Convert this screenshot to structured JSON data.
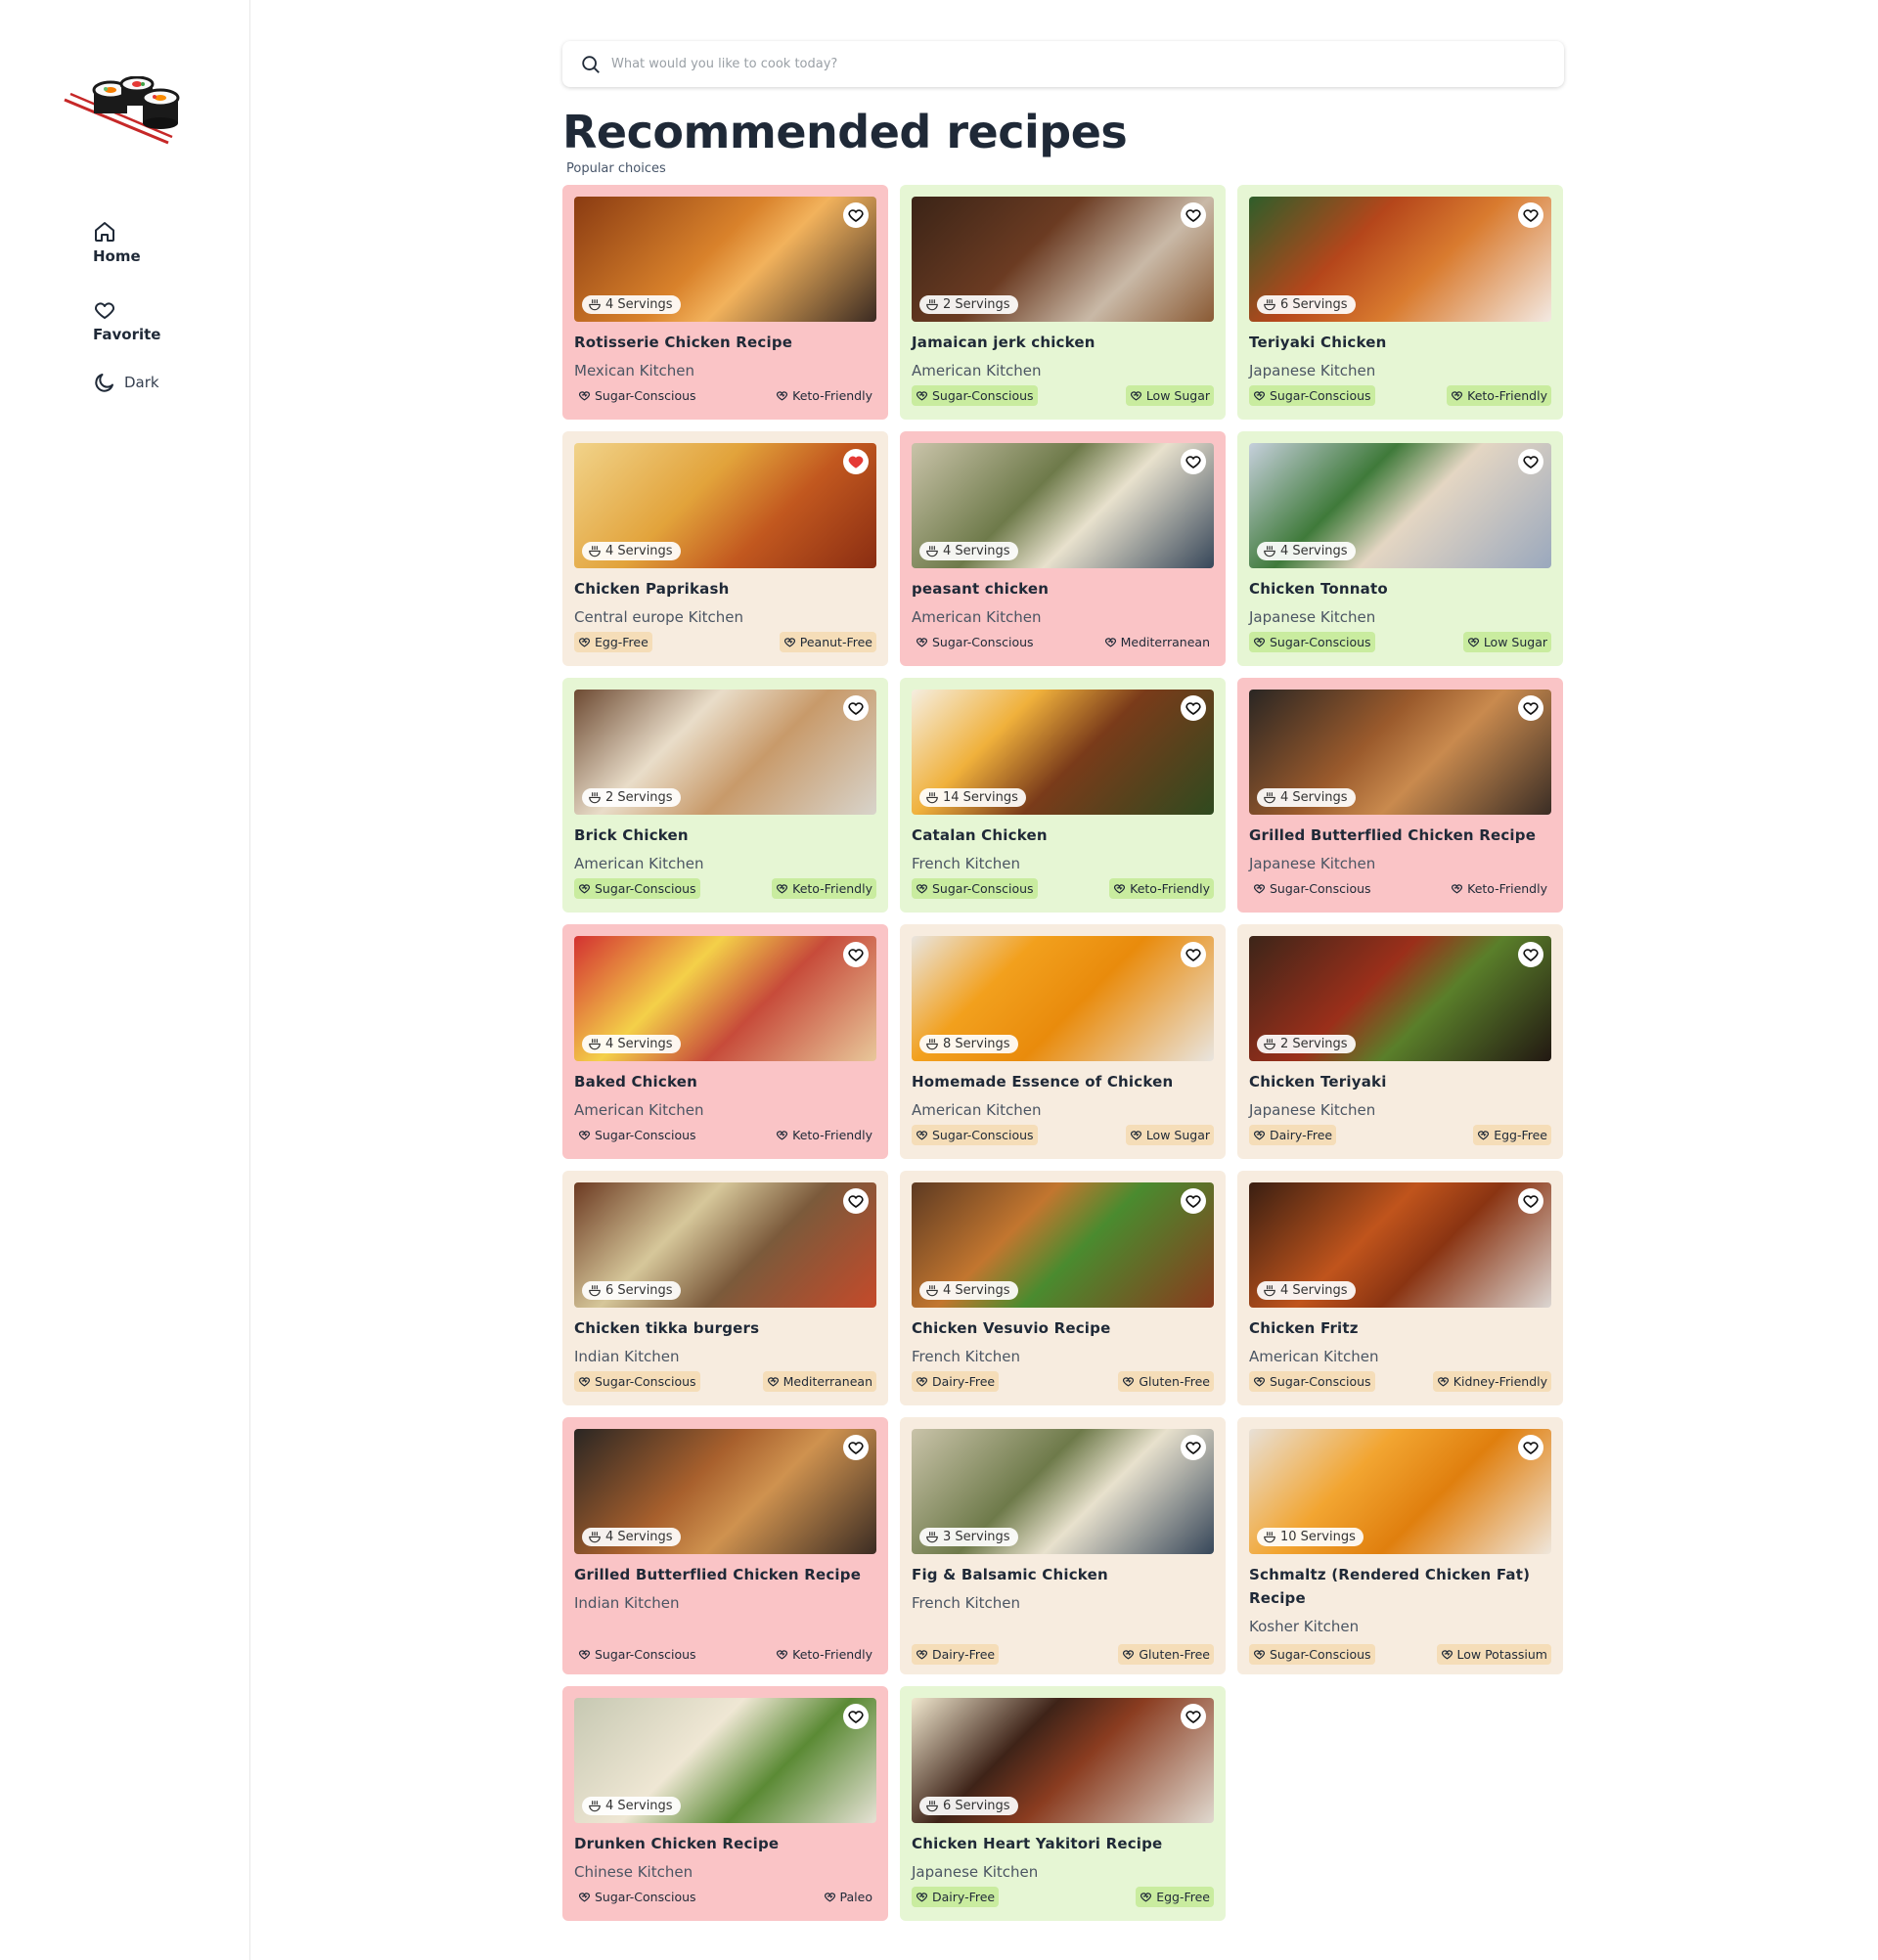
{
  "sidebar": {
    "nav": [
      {
        "label": "Home",
        "icon": "home-icon"
      },
      {
        "label": "Favorite",
        "icon": "heart-icon"
      },
      {
        "label": "Dark",
        "icon": "moon-icon"
      }
    ]
  },
  "search": {
    "placeholder": "What would you like to cook today?",
    "value": ""
  },
  "header": {
    "title": "Recommended recipes",
    "subtitle": "Popular choices"
  },
  "colors": {
    "pink": "#fac4c6",
    "green": "#e6f6d4",
    "beige": "#f7ecdf",
    "fav_active": "#e53935"
  },
  "recipes": [
    {
      "title": "Rotisserie Chicken Recipe",
      "kitchen": "Mexican Kitchen",
      "servings": "4 Servings",
      "tags": [
        "Sugar-Conscious",
        "Keto-Friendly"
      ],
      "color": "pink",
      "favorite": false
    },
    {
      "title": "Jamaican jerk chicken",
      "kitchen": "American Kitchen",
      "servings": "2 Servings",
      "tags": [
        "Sugar-Conscious",
        "Low Sugar"
      ],
      "color": "green",
      "favorite": false
    },
    {
      "title": "Teriyaki Chicken",
      "kitchen": "Japanese Kitchen",
      "servings": "6 Servings",
      "tags": [
        "Sugar-Conscious",
        "Keto-Friendly"
      ],
      "color": "green",
      "favorite": false
    },
    {
      "title": "Chicken Paprikash",
      "kitchen": "Central europe Kitchen",
      "servings": "4 Servings",
      "tags": [
        "Egg-Free",
        "Peanut-Free"
      ],
      "color": "beige",
      "favorite": true
    },
    {
      "title": "peasant chicken",
      "kitchen": "American Kitchen",
      "servings": "4 Servings",
      "tags": [
        "Sugar-Conscious",
        "Mediterranean"
      ],
      "color": "pink",
      "favorite": false
    },
    {
      "title": "Chicken Tonnato",
      "kitchen": "Japanese Kitchen",
      "servings": "4 Servings",
      "tags": [
        "Sugar-Conscious",
        "Low Sugar"
      ],
      "color": "green",
      "favorite": false
    },
    {
      "title": "Brick Chicken",
      "kitchen": "American Kitchen",
      "servings": "2 Servings",
      "tags": [
        "Sugar-Conscious",
        "Keto-Friendly"
      ],
      "color": "green",
      "favorite": false
    },
    {
      "title": "Catalan Chicken",
      "kitchen": "French Kitchen",
      "servings": "14 Servings",
      "tags": [
        "Sugar-Conscious",
        "Keto-Friendly"
      ],
      "color": "green",
      "favorite": false
    },
    {
      "title": "Grilled Butterflied Chicken Recipe",
      "kitchen": "Japanese Kitchen",
      "servings": "4 Servings",
      "tags": [
        "Sugar-Conscious",
        "Keto-Friendly"
      ],
      "color": "pink",
      "favorite": false
    },
    {
      "title": "Baked Chicken",
      "kitchen": "American Kitchen",
      "servings": "4 Servings",
      "tags": [
        "Sugar-Conscious",
        "Keto-Friendly"
      ],
      "color": "pink",
      "favorite": false
    },
    {
      "title": "Homemade Essence of Chicken",
      "kitchen": "American Kitchen",
      "servings": "8 Servings",
      "tags": [
        "Sugar-Conscious",
        "Low Sugar"
      ],
      "color": "beige",
      "favorite": false
    },
    {
      "title": "Chicken Teriyaki",
      "kitchen": "Japanese Kitchen",
      "servings": "2 Servings",
      "tags": [
        "Dairy-Free",
        "Egg-Free"
      ],
      "color": "beige",
      "favorite": false
    },
    {
      "title": "Chicken tikka burgers",
      "kitchen": "Indian Kitchen",
      "servings": "6 Servings",
      "tags": [
        "Sugar-Conscious",
        "Mediterranean"
      ],
      "color": "beige",
      "favorite": false
    },
    {
      "title": "Chicken Vesuvio Recipe",
      "kitchen": "French Kitchen",
      "servings": "4 Servings",
      "tags": [
        "Dairy-Free",
        "Gluten-Free"
      ],
      "color": "beige",
      "favorite": false
    },
    {
      "title": "Chicken Fritz",
      "kitchen": "American Kitchen",
      "servings": "4 Servings",
      "tags": [
        "Sugar-Conscious",
        "Kidney-Friendly"
      ],
      "color": "beige",
      "favorite": false
    },
    {
      "title": "Grilled Butterflied Chicken Recipe",
      "kitchen": "Indian Kitchen",
      "servings": "4 Servings",
      "tags": [
        "Sugar-Conscious",
        "Keto-Friendly"
      ],
      "color": "pink",
      "favorite": false
    },
    {
      "title": "Fig & Balsamic Chicken",
      "kitchen": "French Kitchen",
      "servings": "3 Servings",
      "tags": [
        "Dairy-Free",
        "Gluten-Free"
      ],
      "color": "beige",
      "favorite": false
    },
    {
      "title": "Schmaltz (Rendered Chicken Fat) Recipe",
      "kitchen": "Kosher Kitchen",
      "servings": "10 Servings",
      "tags": [
        "Sugar-Conscious",
        "Low Potassium"
      ],
      "color": "beige",
      "favorite": false
    },
    {
      "title": "Drunken Chicken Recipe",
      "kitchen": "Chinese Kitchen",
      "servings": "4 Servings",
      "tags": [
        "Sugar-Conscious",
        "Paleo"
      ],
      "color": "pink",
      "favorite": false
    },
    {
      "title": "Chicken Heart Yakitori Recipe",
      "kitchen": "Japanese Kitchen",
      "servings": "6 Servings",
      "tags": [
        "Dairy-Free",
        "Egg-Free"
      ],
      "color": "green",
      "favorite": false
    }
  ]
}
